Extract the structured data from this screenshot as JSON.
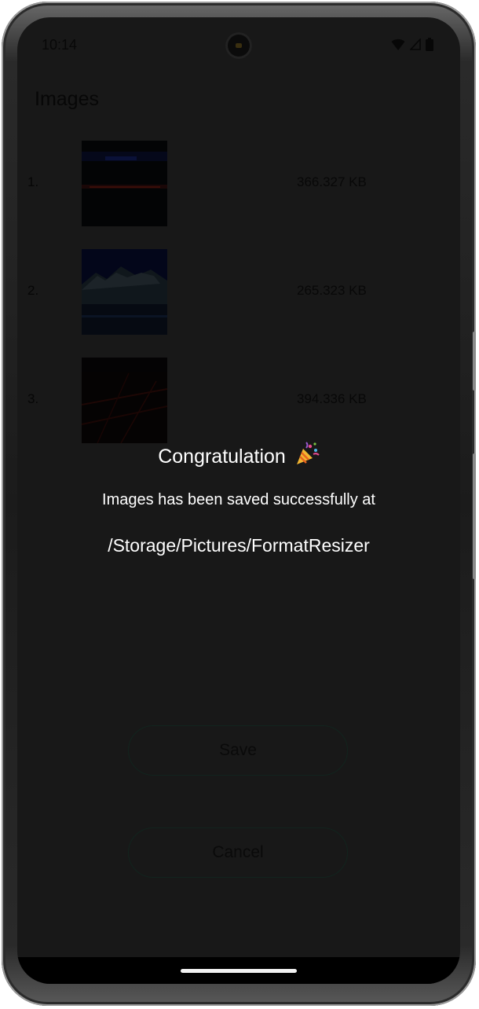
{
  "status_bar": {
    "time": "10:14",
    "icons": [
      "wifi-icon",
      "signal-icon",
      "battery-icon"
    ]
  },
  "app": {
    "title": "Images"
  },
  "images": [
    {
      "index": "1.",
      "size": "366.327 KB",
      "thumb": "night-city-thumbnail"
    },
    {
      "index": "2.",
      "size": "265.323 KB",
      "thumb": "mountain-lake-thumbnail"
    },
    {
      "index": "3.",
      "size": "394.336 KB",
      "thumb": "city-lights-thumbnail"
    }
  ],
  "dialog": {
    "title": "Congratulation",
    "title_icon": "party-popper-icon",
    "message": "Images has been saved successfully at",
    "path": "/Storage/Pictures/FormatResizer"
  },
  "buttons": {
    "save_label": "Save",
    "cancel_label": "Cancel"
  },
  "colors": {
    "screen_background": "#181818",
    "dialog_text": "#ffffff",
    "button_border": "#12241e"
  }
}
